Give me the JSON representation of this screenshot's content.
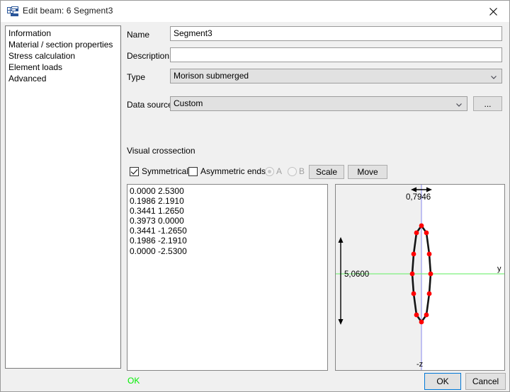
{
  "window": {
    "title": "Edit beam: 6 Segment3",
    "icon": "beam-edit-icon",
    "close_icon": "close-icon"
  },
  "sidebar": {
    "items": [
      {
        "label": "Information"
      },
      {
        "label": "Material / section properties"
      },
      {
        "label": "Stress calculation"
      },
      {
        "label": "Element loads"
      },
      {
        "label": "Advanced"
      }
    ]
  },
  "form": {
    "name_label": "Name",
    "name_value": "Segment3",
    "description_label": "Description",
    "description_value": "",
    "type_label": "Type",
    "type_value": "Morison submerged",
    "datasource_label": "Data source",
    "datasource_value": "Custom",
    "browse_label": "...",
    "section_title": "Visual crossection"
  },
  "options": {
    "symmetrical_label": "Symmetrical",
    "symmetrical_checked": true,
    "asymmetric_ends_label": "Asymmetric ends",
    "asymmetric_ends_checked": false,
    "radio_a_label": "A",
    "radio_b_label": "B",
    "radio_selected": "A",
    "radios_disabled": true,
    "scale_label": "Scale",
    "move_label": "Move"
  },
  "coordinates": {
    "lines": [
      "0.0000 2.5300",
      "0.1986 2.1910",
      "0.3441 1.2650",
      "0.3973 0.0000",
      "0.3441 -1.2650",
      "0.1986 -2.1910",
      "0.0000 -2.5300"
    ]
  },
  "drawing": {
    "width_dimension": "0,7946",
    "height_dimension": "5,0600",
    "axis_y_label": "y",
    "axis_z_label": "-z",
    "axis_y_color": "#7cf07c",
    "axis_z_color": "#9a9aee",
    "point_color": "#ff0000",
    "outline_color": "#141414",
    "left_half_fill": "#f0f0f0",
    "right_half_fill": "#ffffff"
  },
  "status": {
    "message": "OK",
    "color": "#00ee00"
  },
  "buttons": {
    "ok_label": "OK",
    "cancel_label": "Cancel"
  }
}
